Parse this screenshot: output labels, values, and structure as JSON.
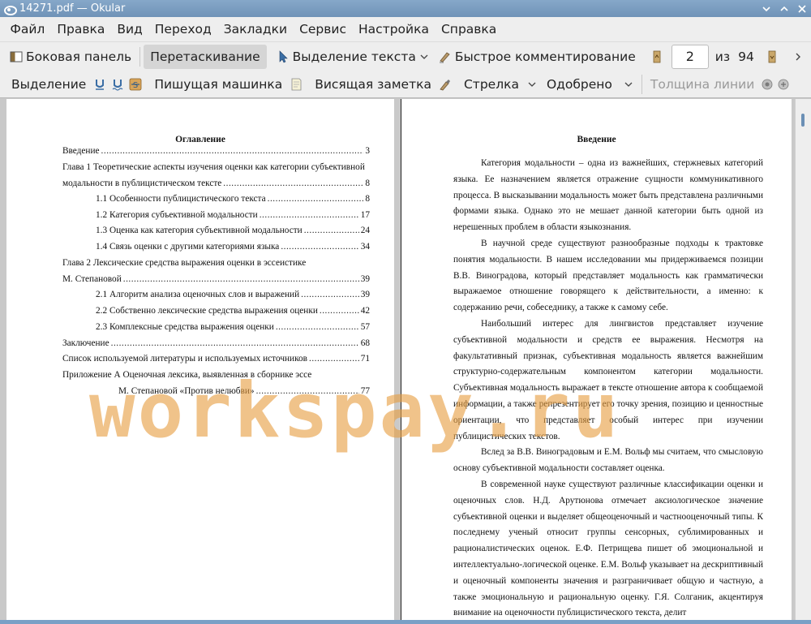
{
  "window": {
    "title": "14271.pdf — Okular"
  },
  "menu": [
    "Файл",
    "Правка",
    "Вид",
    "Переход",
    "Закладки",
    "Сервис",
    "Настройка",
    "Справка"
  ],
  "toolbar1": {
    "sidebar": "Боковая панель",
    "drag": "Перетаскивание",
    "text_select": "Выделение текста",
    "quick_comment": "Быстрое комментирование",
    "page_current": "2",
    "of_label": "из",
    "page_total": "94"
  },
  "toolbar2": {
    "highlight": "Выделение",
    "typewriter": "Пишущая машинка",
    "popup_note": "Висящая заметка",
    "arrow": "Стрелка",
    "approved": "Одобрено",
    "line_width": "Толщина линии"
  },
  "left_page": {
    "title": "Оглавление",
    "entries": [
      {
        "text": "Введение",
        "page": "3"
      },
      {
        "text": "Глава 1 Теоретические аспекты изучения оценки как категории субъективной",
        "page": ""
      },
      {
        "text": "модальности в публицистическом тексте",
        "page": "8"
      },
      {
        "text": "1.1 Особенности публицистического текста",
        "page": "8"
      },
      {
        "text": "1.2 Категория субъективной модальности",
        "page": "17"
      },
      {
        "text": "1.3 Оценка как категория субъективной модальности",
        "page": "24"
      },
      {
        "text": "1.4 Связь оценки с другими категориями языка",
        "page": "34"
      },
      {
        "text": "Глава 2 Лексические средства выражения оценки в эссеистике",
        "page": ""
      },
      {
        "text": "М. Степановой",
        "page": "39"
      },
      {
        "text": "2.1 Алгоритм анализа оценочных слов и выражений",
        "page": "39"
      },
      {
        "text": "2.2 Собственно лексические средства выражения оценки",
        "page": "42"
      },
      {
        "text": "2.3 Комплексные средства выражения оценки",
        "page": "57"
      },
      {
        "text": "Заключение",
        "page": "68"
      },
      {
        "text": "Список используемой литературы и используемых источников",
        "page": "71"
      },
      {
        "text": "Приложение А Оценочная лексика, выявленная в сборнике эссе",
        "page": ""
      },
      {
        "text": "М. Степановой «Против нелюбви»",
        "page": "77"
      }
    ]
  },
  "right_page": {
    "title": "Введение",
    "paragraphs": [
      "Категория модальности – одна из важнейших, стержневых категорий языка. Ее назначением является отражение сущности коммуникативного процесса. В высказывании модальность может быть представлена различными формами языка. Однако это не мешает данной категории быть одной из нерешенных проблем в области языкознания.",
      "В научной среде существуют разнообразные подходы к трактовке понятия модальности. В нашем исследовании мы придерживаемся позиции В.В. Виноградова, который представляет модальность как грамматически выражаемое отношение говорящего к действительности, а именно: к содержанию речи, собеседнику, а также к самому себе.",
      "Наибольший интерес для лингвистов представляет изучение субъективной модальности и средств ее выражения. Несмотря на факультативный признак, субъективная модальность является важнейшим структурно-содержательным компонентом категории модальности. Субъективная модальность выражает в тексте отношение автора к сообщаемой информации, а также репрезентирует его точку зрения, позицию и ценностные ориентации, что представляет особый интерес при изучении публицистических текстов.",
      "Вслед за В.В. Виноградовым и Е.М. Вольф мы считаем, что смысловую основу субъективной модальности составляет оценка.",
      "В современной науке существуют различные классификации оценки и оценочных слов. Н.Д. Арутюнова отмечает аксиологическое значение субъективной оценки и выделяет общеоценочный и частнооценочный типы. К последнему ученый относит группы сенсорных, сублимированных и рационалистических оценок. Е.Ф. Петрищева пишет об эмоциональной и интеллектуально-логической оценке. Е.М. Вольф указывает на дескриптивный и оценочный компоненты значения и разграничивает общую и частную, а также эмоциональную и рациональную оценку. Г.Я. Солганик, акцентируя внимание на оценочности публицистического текста, делит"
    ]
  },
  "watermark": "workspay.ru",
  "colors": {
    "titlebar": "#7a9fc4",
    "toolbar_bg": "#eeeeee",
    "watermark": "#e89e42",
    "accent": "#6b8fb5"
  },
  "icons": [
    "okular-app-icon",
    "minimize-icon",
    "maximize-icon",
    "close-icon",
    "sidebar-icon",
    "cursor-icon",
    "chevron-down-icon",
    "pen-icon",
    "prev-page-icon",
    "next-page-icon",
    "chevron-right-icon",
    "underline-icon",
    "squiggle-icon",
    "strikeout-icon",
    "note-icon",
    "brush-icon",
    "stamp-icon"
  ]
}
